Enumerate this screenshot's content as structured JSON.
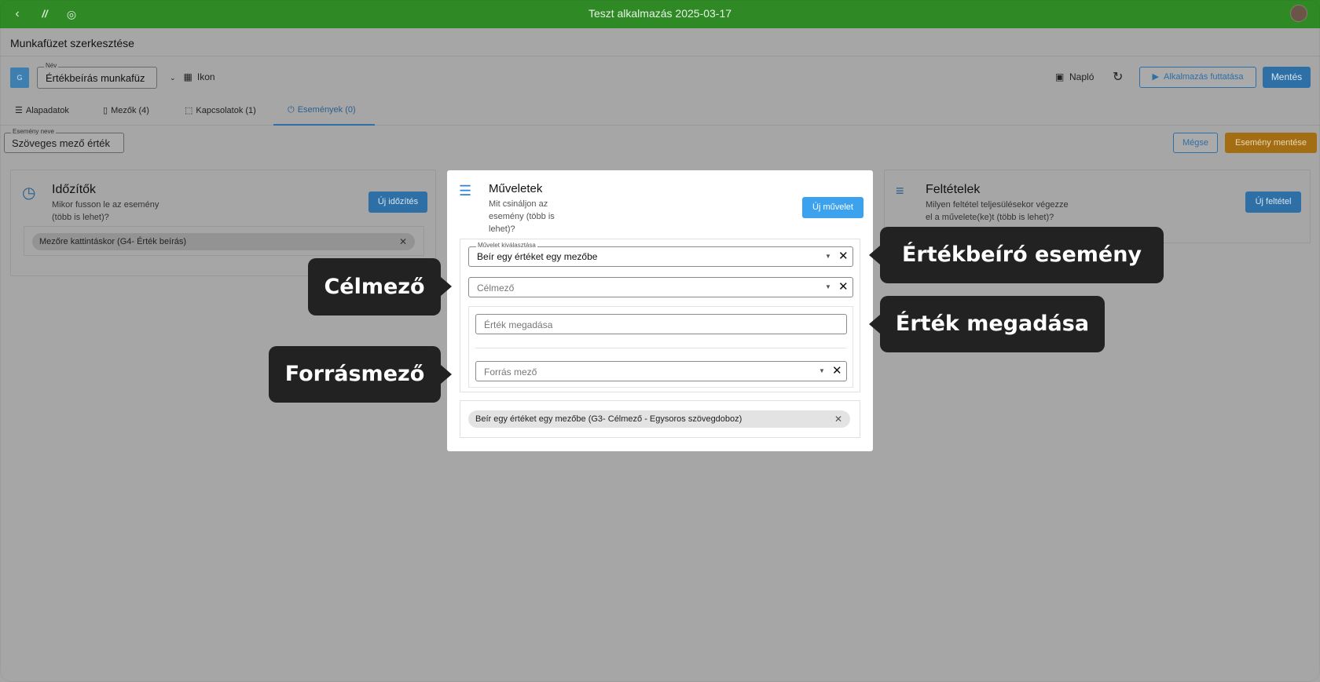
{
  "window": {
    "title": "Teszt alkalmazás 2025-03-17"
  },
  "page": {
    "title": "Munkafüzet szerkesztése"
  },
  "toolbar": {
    "badge": "G",
    "name_label": "Név",
    "name_value": "Értékbeírás munkafüz",
    "icon_label": "Ikon",
    "log_label": "Napló",
    "run_label": "Alkalmazás futtatása",
    "save_label": "Mentés"
  },
  "tabs": [
    {
      "label": "Alapadatok"
    },
    {
      "label": "Mezők (4)"
    },
    {
      "label": "Kapcsolatok (1)"
    },
    {
      "label": "Események (0)"
    }
  ],
  "event": {
    "name_label": "Esemény neve",
    "name_value": "Szöveges mező érték",
    "cancel_label": "Mégse",
    "save_label": "Esemény mentése"
  },
  "timers": {
    "title": "Időzítők",
    "subtitle": "Mikor fusson le az esemény (több is lehet)?",
    "button": "Új időzítés",
    "chip": "Mezőre kattintáskor (G4- Érték beírás)"
  },
  "conditions": {
    "title": "Feltételek",
    "subtitle": "Milyen feltétel teljesülésekor végezze el a művelete(ke)t (több is lehet)?",
    "button": "Új feltétel"
  },
  "operations": {
    "title": "Műveletek",
    "subtitle": "Mit csináljon az esemény (több is lehet)?",
    "button": "Új művelet",
    "select_label": "Művelet kiválasztása",
    "select_value": "Beír egy értéket egy mezőbe",
    "target_placeholder": "Célmező",
    "value_placeholder": "Érték megadása",
    "source_placeholder": "Forrás mező",
    "chip": "Beír egy értéket egy mezőbe (G3- Célmező - Egysoros szövegdoboz)"
  },
  "callouts": {
    "write_event": "Értékbeíró esemény",
    "target_field": "Célmező",
    "value_input": "Érték megadása",
    "source_field": "Forrásmező"
  }
}
